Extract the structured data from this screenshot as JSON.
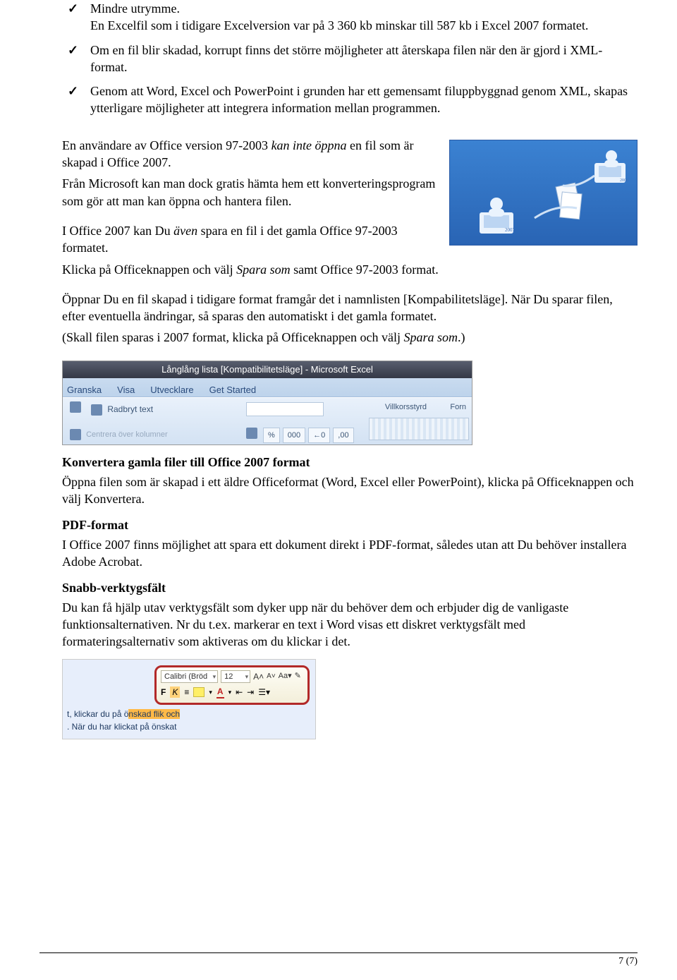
{
  "bullets": [
    {
      "lead": "Mindre utrymme.",
      "rest": "En Excelfil som i tidigare Excelversion var på 3 360 kb minskar till 587 kb i Excel 2007 formatet."
    },
    {
      "lead": "",
      "rest": "Om en fil blir skadad, korrupt finns det större möjligheter att återskapa filen när den är gjord i XML-format."
    },
    {
      "lead": "",
      "rest": "Genom att Word, Excel och PowerPoint i grunden har ett gemensamt filuppbyggnad genom XML, skapas ytterligare möjligheter att integrera information mellan programmen."
    }
  ],
  "para1a": "En användare av Office version 97-2003 ",
  "para1b": "kan inte öppna",
  "para1c": " en fil som är skapad i Office 2007.",
  "para2": "Från Microsoft kan man dock gratis hämta hem ett konverteringsprogram som gör att man kan öppna och hantera filen.",
  "para3a": "I Office 2007 kan Du ",
  "para3b": "även",
  "para3c": " spara en fil i det gamla Office 97-2003 formatet.",
  "para4a": "Klicka på Officeknappen och välj ",
  "para4b": "Spara som",
  "para4c": " samt Office 97-2003 format.",
  "para5": "Öppnar Du en fil skapad i tidigare format framgår det i namnlisten [Kompabilitetsläge]. När Du sparar filen, efter eventuella ändringar, så sparas den automatiskt i det gamla formatet.",
  "para6a": "(Skall filen sparas i 2007 format, klicka på Officeknappen och välj ",
  "para6b": "Spara som",
  "para6c": ".)",
  "shot1": {
    "title": "Långlång lista  [Kompatibilitetsläge] - Microsoft Excel",
    "tabs": [
      "Granska",
      "Visa",
      "Utvecklare",
      "Get Started"
    ],
    "wrap_label": "Radbryt text",
    "strip_left": "Centrera över kolumner",
    "num_btns": [
      "%",
      "000",
      "←0",
      ",00"
    ],
    "cond": "Villkorsstyrd",
    "form": "Forn"
  },
  "h_convert": "Konvertera gamla filer till Office 2007 format",
  "p_convert": "Öppna filen som är skapad i ett äldre Officeformat (Word, Excel eller PowerPoint), klicka på Officeknappen och välj Konvertera.",
  "h_pdf": "PDF-format",
  "p_pdf": "I Office 2007 finns möjlighet att spara ett dokument direkt i PDF-format, således utan att Du behöver installera Adobe Acrobat.",
  "h_snabb": "Snabb-verktygsfält",
  "p_snabb": "Du kan få hjälp utav verktygsfält som dyker upp när du behöver dem och erbjuder dig de vanligaste funktionsalternativen. Nr du t.ex. markerar en text i Word visas ett diskret verktygsfält med formateringsalternativ som aktiveras om du klickar i det.",
  "shot2": {
    "font": "Calibri (Bröd",
    "size": "12",
    "line1a": "t, klickar du på ö",
    "line1sel": "nskad flik och",
    "line2": ". När du har klickat på önskat"
  },
  "footer": "7 (7)"
}
